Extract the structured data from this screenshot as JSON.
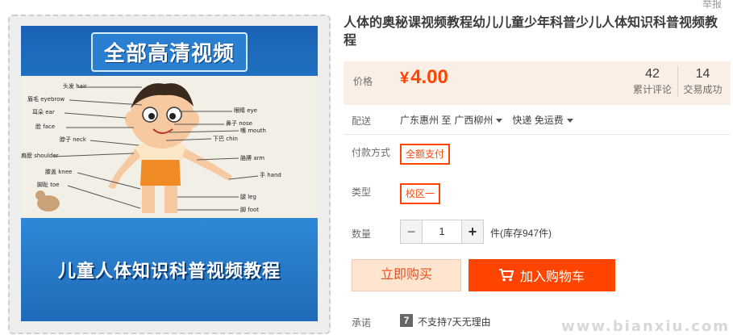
{
  "report_link": "举报",
  "product": {
    "title": "人体的奥秘课视频教程幼儿儿童少年科普少儿人体知识科普视频教程",
    "image": {
      "top_banner": "全部高清视频",
      "bottom_banner": "儿童人体知识科普视频教程",
      "diagram_labels_left": [
        "头发 hair",
        "眉毛 eyebrow",
        "耳朵 ear",
        "脸 face",
        "脖子 neck",
        "肩膀 shoulder",
        "膝盖 knee",
        "脚趾 toe"
      ],
      "diagram_labels_right": [
        "眼睛 eye",
        "鼻子 nose",
        "嘴 mouth",
        "下巴 chin",
        "胳膊 arm",
        "手 hand",
        "腿 leg",
        "脚 foot"
      ]
    }
  },
  "price": {
    "label": "价格",
    "currency": "¥",
    "value": "4.00"
  },
  "stats": {
    "reviews": {
      "count": "42",
      "label": "累计评论"
    },
    "trades": {
      "count": "14",
      "label": "交易成功"
    }
  },
  "shipping": {
    "label": "配送",
    "from": "广东惠州 至",
    "to": "广西柳州",
    "method": "快递 免运费"
  },
  "payment": {
    "label": "付款方式",
    "option": "全额支付"
  },
  "type": {
    "label": "类型",
    "option": "校区一"
  },
  "quantity": {
    "label": "数量",
    "minus": "−",
    "value": "1",
    "plus": "+",
    "stock": "件(库存947件)"
  },
  "actions": {
    "buy_now": "立即购买",
    "add_to_cart": "加入购物车"
  },
  "promise": {
    "label": "承诺",
    "icon_text": "7",
    "text": "不支持7天无理由"
  },
  "watermark": "www.bianxiu.com",
  "colors": {
    "accent": "#ff4400",
    "price_bg": "#fbeee4",
    "buy_now_bg": "#ffe4d0"
  }
}
